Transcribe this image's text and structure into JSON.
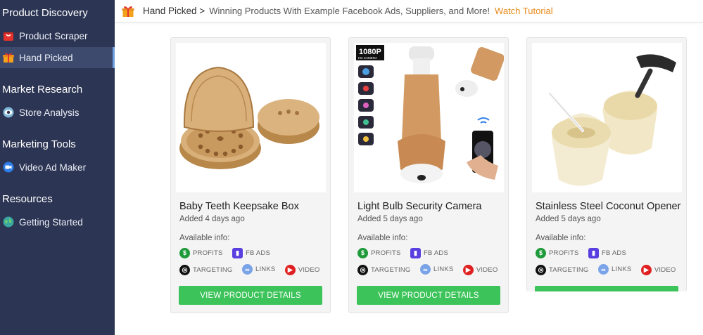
{
  "sidebar": {
    "sections": [
      {
        "title": "Product Discovery",
        "items": [
          {
            "label": "Product Scraper",
            "icon": "shopping-bag-icon",
            "active": false
          },
          {
            "label": "Hand Picked",
            "icon": "gift-icon",
            "active": true
          }
        ]
      },
      {
        "title": "Market Research",
        "items": [
          {
            "label": "Store Analysis",
            "icon": "eye-icon",
            "active": false
          }
        ]
      },
      {
        "title": "Marketing Tools",
        "items": [
          {
            "label": "Video Ad Maker",
            "icon": "video-camera-icon",
            "active": false
          }
        ]
      },
      {
        "title": "Resources",
        "items": [
          {
            "label": "Getting Started",
            "icon": "globe-icon",
            "active": false
          }
        ]
      }
    ]
  },
  "topbar": {
    "crumb": "Hand Picked >",
    "description": "Winning Products With Example Facebook Ads, Suppliers, and More!",
    "watch_link": "Watch Tutorial"
  },
  "cards": [
    {
      "title": "Baby Teeth Keepsake Box",
      "added": "Added 4 days ago"
    },
    {
      "title": "Light Bulb Security Camera",
      "added": "Added 5 days ago"
    },
    {
      "title": "Stainless Steel Coconut Opener",
      "added": "Added 5 days ago"
    }
  ],
  "card_common": {
    "available_label": "Available info:",
    "badges": {
      "profits": "PROFITS",
      "fb_ads": "FB ADS",
      "targeting": "TARGETING",
      "links": "LINKS",
      "video": "VIDEO"
    },
    "button_label": "VIEW PRODUCT DETAILS"
  },
  "camera_image": {
    "tag_line1": "1080P",
    "tag_line2": "HD CAMERA"
  },
  "colors": {
    "sidebar_bg": "#2c3554",
    "accent_orange": "#e8891a",
    "button_green": "#3cc35a"
  }
}
